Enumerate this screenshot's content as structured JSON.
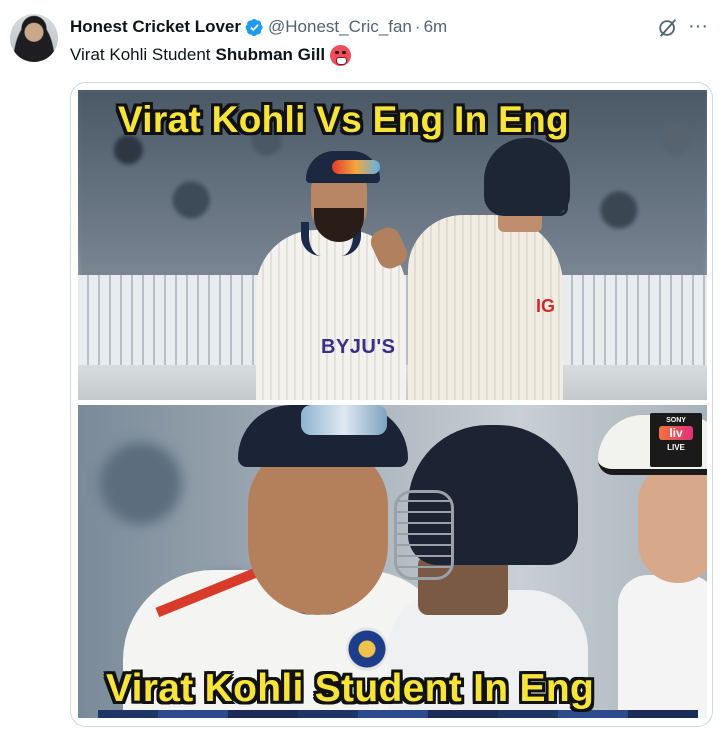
{
  "tweet": {
    "author": {
      "display_name": "Honest Cricket Lover",
      "handle": "@Honest_Cric_fan",
      "separator": "·",
      "time": "6m",
      "verified": true
    },
    "text_prefix": "Virat Kohli Student",
    "text_bold": "Shubman Gill",
    "emoji": "hot-face-emoji",
    "media": {
      "caption_top": "Virat Kohli Vs Eng In Eng",
      "caption_bottom": "Virat Kohli Student In Eng",
      "sponsor_text": "BYJU'S",
      "team_logo": "IG",
      "broadcaster": {
        "brand": "SONY",
        "channel": "liv",
        "live": "LIVE"
      }
    }
  },
  "icons": {
    "verified": "verified-badge-icon",
    "grok": "grok-icon",
    "more": "more-options-icon"
  },
  "colors": {
    "text_primary": "#0f1419",
    "text_secondary": "#536471",
    "verified_blue": "#1d9bf0",
    "caption_yellow": "#f7e43a",
    "border": "#cfd9de"
  }
}
